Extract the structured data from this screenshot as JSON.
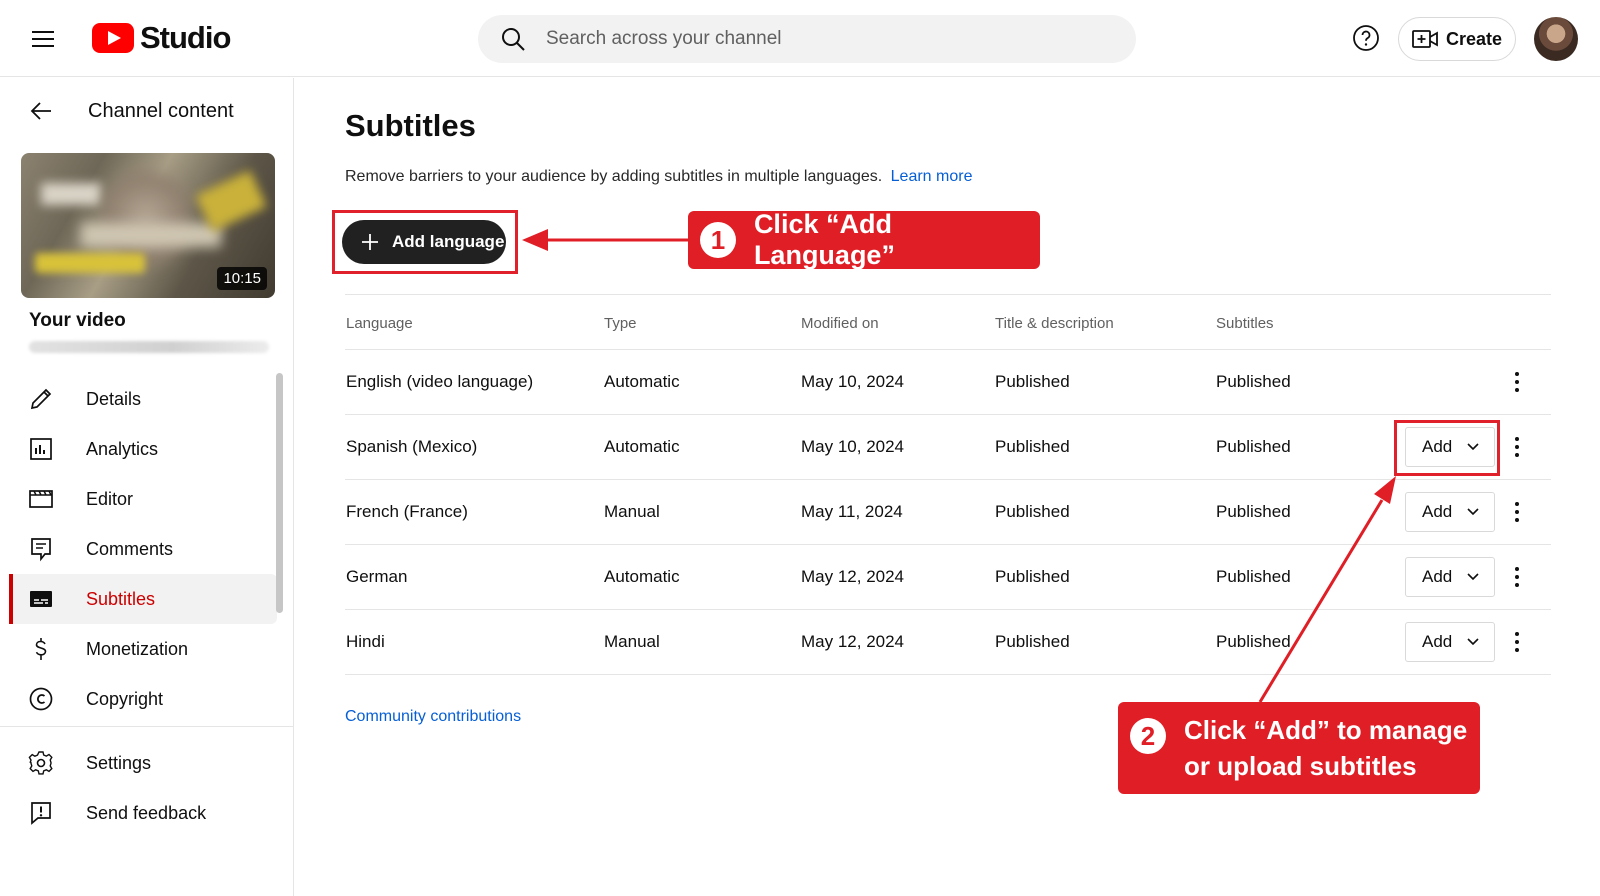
{
  "header": {
    "logo_text": "Studio",
    "search_placeholder": "Search across your channel",
    "create_label": "Create",
    "brand_color": "#ff0000"
  },
  "sidebar": {
    "back_label": "Channel content",
    "video_duration": "10:15",
    "your_video_label": "Your video",
    "nav_items": [
      {
        "label": "Details",
        "icon": "pencil-icon"
      },
      {
        "label": "Analytics",
        "icon": "bar-chart-icon"
      },
      {
        "label": "Editor",
        "icon": "clapperboard-icon"
      },
      {
        "label": "Comments",
        "icon": "comment-icon"
      },
      {
        "label": "Subtitles",
        "icon": "subtitles-icon",
        "active": true
      },
      {
        "label": "Monetization",
        "icon": "dollar-icon"
      },
      {
        "label": "Copyright",
        "icon": "copyright-icon"
      }
    ],
    "bottom_items": [
      {
        "label": "Settings",
        "icon": "gear-icon"
      },
      {
        "label": "Send feedback",
        "icon": "feedback-icon"
      }
    ],
    "active_color": "#cc0000"
  },
  "main": {
    "title": "Subtitles",
    "description": "Remove barriers to your audience by adding subtitles in multiple languages.",
    "learn_more": "Learn more",
    "add_language_label": "Add language",
    "table": {
      "columns": [
        "Language",
        "Type",
        "Modified on",
        "Title & description",
        "Subtitles"
      ],
      "rows": [
        {
          "language": "English (video language)",
          "type": "Automatic",
          "modified": "May 10, 2024",
          "title_desc": "Published",
          "subtitles": "Published",
          "action": ""
        },
        {
          "language": "Spanish (Mexico)",
          "type": "Automatic",
          "modified": "May 10, 2024",
          "title_desc": "Published",
          "subtitles": "Published",
          "action": "Add"
        },
        {
          "language": "French (France)",
          "type": "Manual",
          "modified": "May 11, 2024",
          "title_desc": "Published",
          "subtitles": "Published",
          "action": "Add"
        },
        {
          "language": "German",
          "type": "Automatic",
          "modified": "May 12, 2024",
          "title_desc": "Published",
          "subtitles": "Published",
          "action": "Add"
        },
        {
          "language": "Hindi",
          "type": "Manual",
          "modified": "May 12, 2024",
          "title_desc": "Published",
          "subtitles": "Published",
          "action": "Add"
        }
      ]
    },
    "community_link": "Community contributions"
  },
  "annotations": {
    "callout1_num": "1",
    "callout1_text": "Click “Add Language”",
    "callout2_num": "2",
    "callout2_text": "Click “Add” to manage or upload subtitles",
    "annotation_color": "#e01e26"
  }
}
